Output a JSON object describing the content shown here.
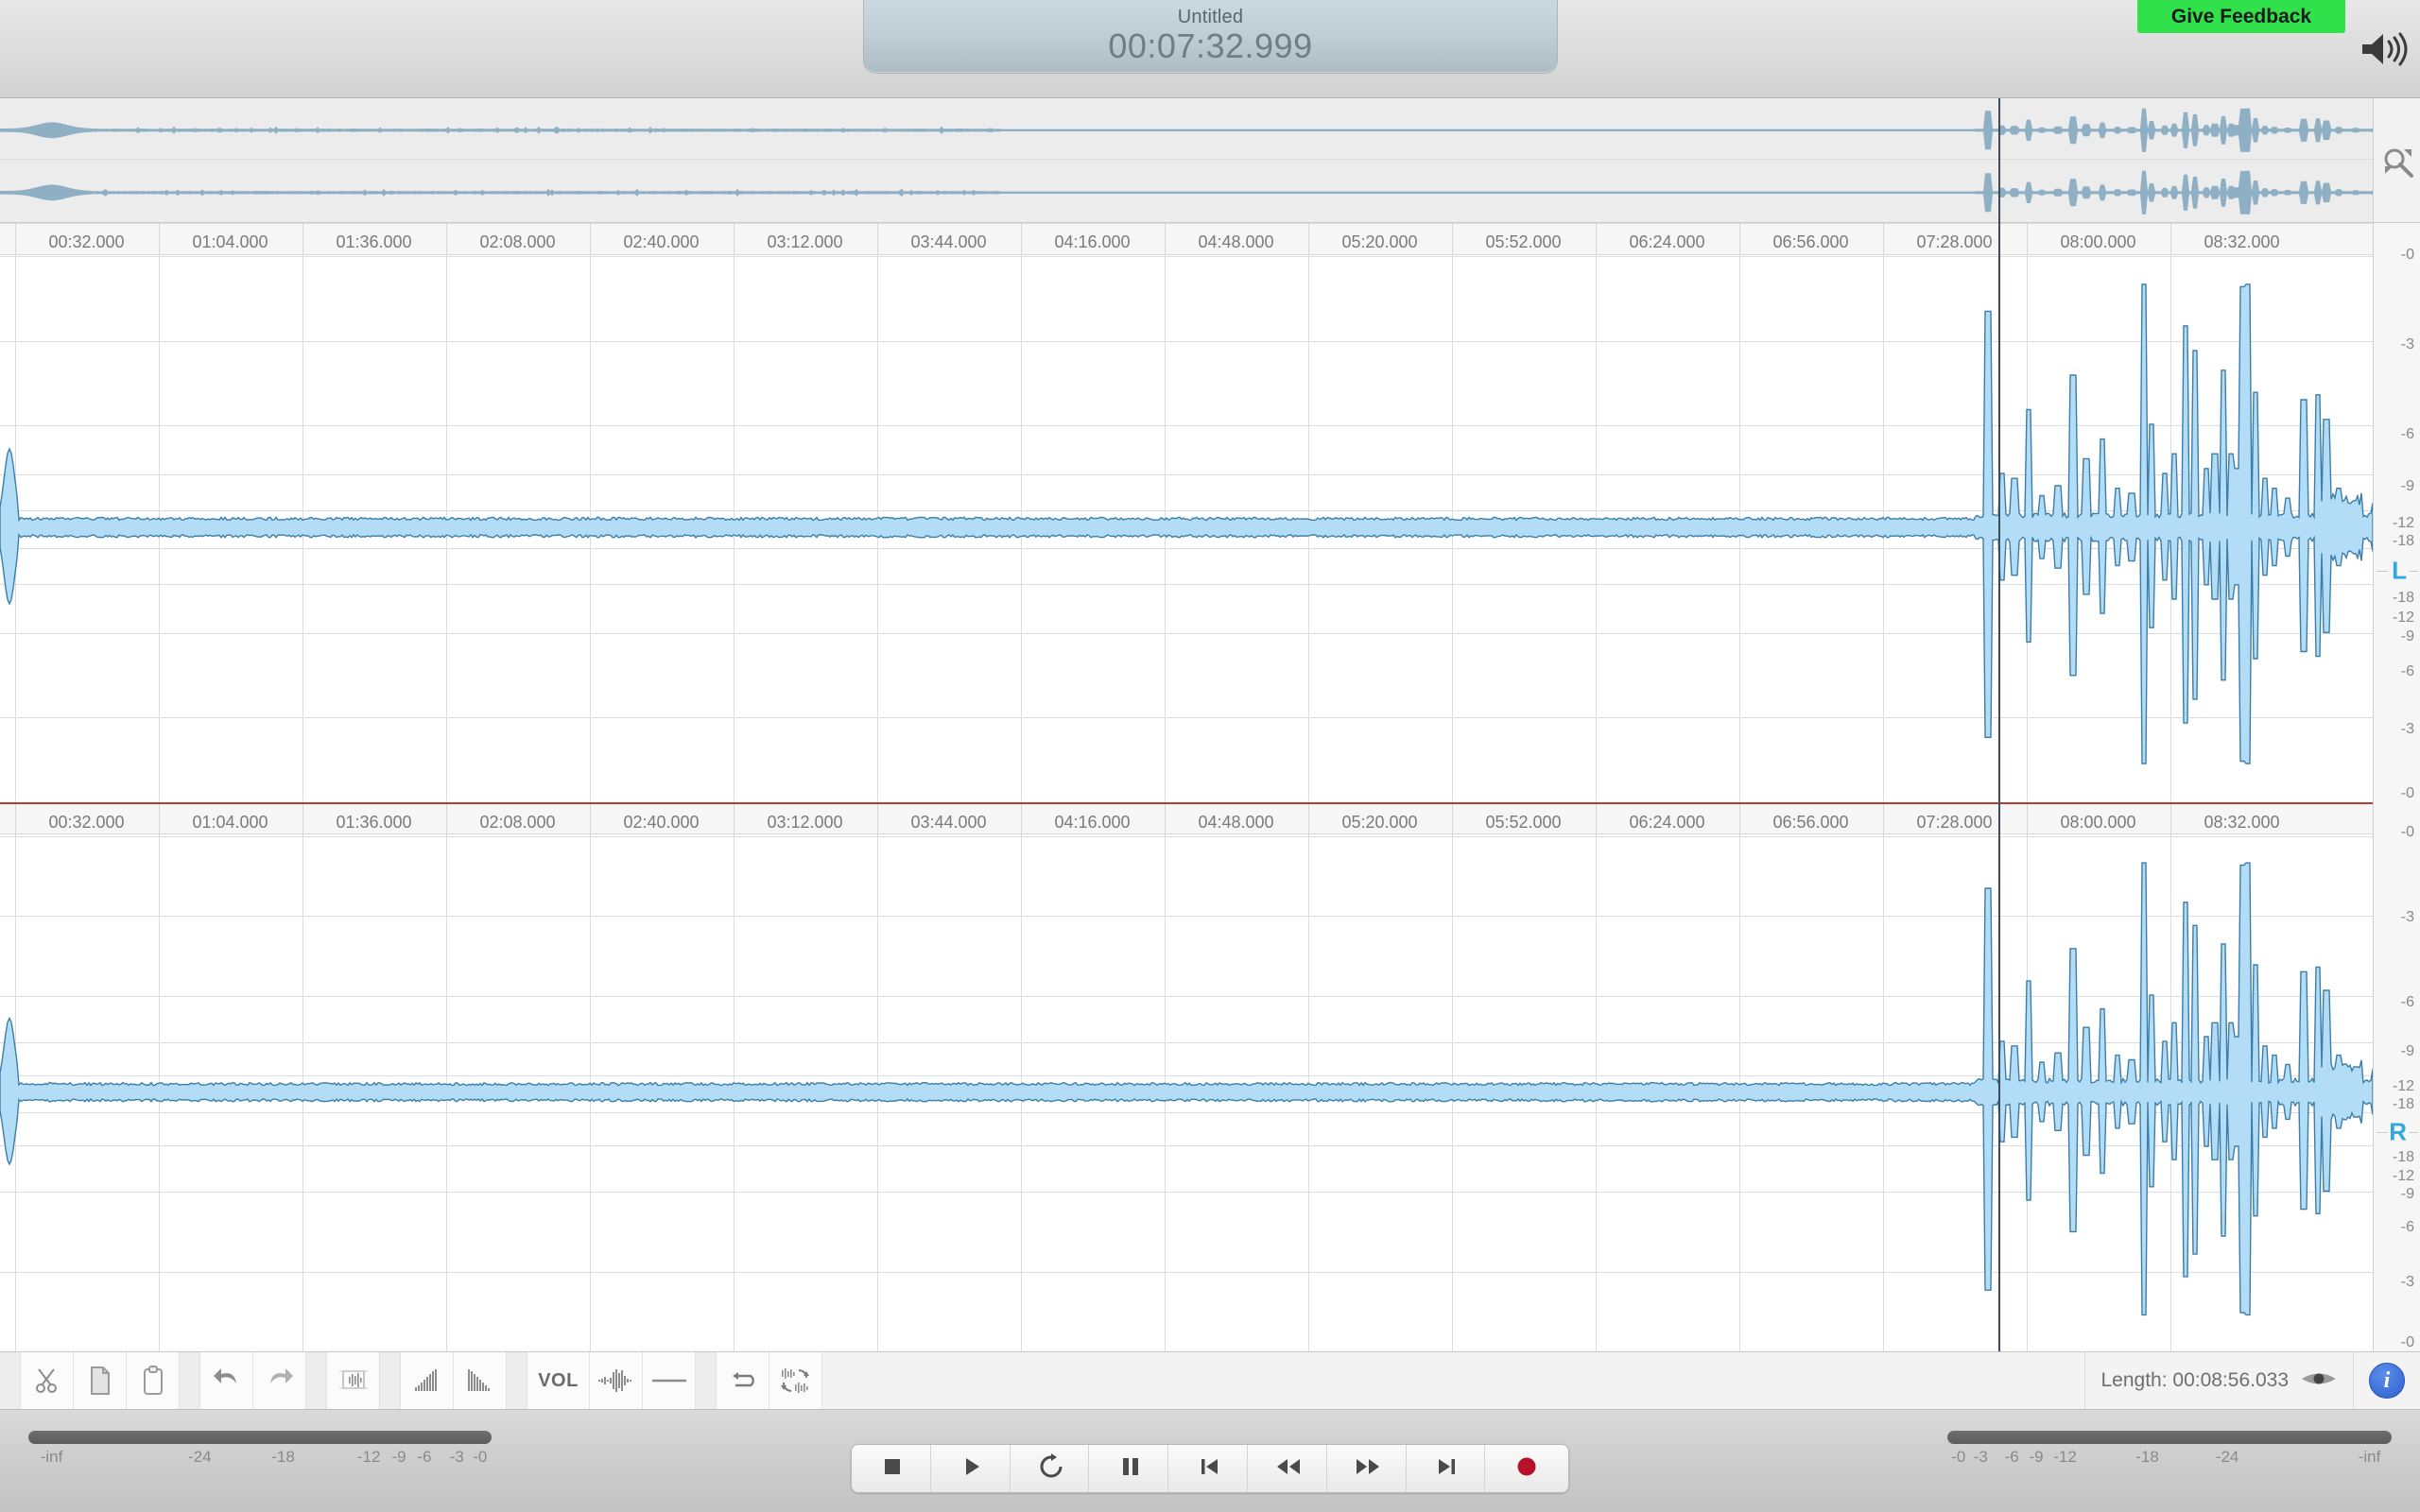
{
  "header": {
    "project_title": "Untitled",
    "playhead_time": "00:07:32.999",
    "feedback_label": "Give Feedback",
    "speaker_icon": "speaker-volume-icon",
    "feedback_color": "#31e14c"
  },
  "overview": {
    "zoom_icon": "zoom-magnifier-icon"
  },
  "ruler": {
    "labels": [
      "00:32.000",
      "01:04.000",
      "01:36.000",
      "02:08.000",
      "02:40.000",
      "03:12.000",
      "03:44.000",
      "04:16.000",
      "04:48.000",
      "05:20.000",
      "05:52.000",
      "06:24.000",
      "06:56.000",
      "07:28.000",
      "08:00.000",
      "08:32.000"
    ]
  },
  "scale": {
    "top_labels": [
      "-0",
      "-3",
      "-6",
      "-9",
      "-12",
      "-18"
    ],
    "bottom_labels": [
      "-18",
      "-12",
      "-9",
      "-6",
      "-3",
      "-0"
    ],
    "channel_left": "L",
    "channel_right": "R",
    "channel_color": "#31a8e0"
  },
  "toolbar": {
    "buttons": [
      {
        "name": "cut-button",
        "icon": "scissors-icon",
        "label": ""
      },
      {
        "name": "copy-button",
        "icon": "copy-icon",
        "label": ""
      },
      {
        "name": "paste-button",
        "icon": "paste-icon",
        "label": ""
      },
      {
        "name": "undo-button",
        "icon": "undo-arrow-icon",
        "label": ""
      },
      {
        "name": "redo-button",
        "icon": "redo-arrow-icon",
        "label": ""
      },
      {
        "name": "crop-selection-button",
        "icon": "crop-waveform-icon",
        "label": ""
      },
      {
        "name": "fade-in-button",
        "icon": "fade-in-icon",
        "label": ""
      },
      {
        "name": "fade-out-button",
        "icon": "fade-out-icon",
        "label": ""
      },
      {
        "name": "volume-button",
        "icon": "vol-text-icon",
        "label": "VOL"
      },
      {
        "name": "normalize-button",
        "icon": "normalize-waveform-icon",
        "label": ""
      },
      {
        "name": "silence-button",
        "icon": "horizontal-line-icon",
        "label": ""
      },
      {
        "name": "loop-region-button",
        "icon": "loop-arrow-icon",
        "label": ""
      },
      {
        "name": "reverse-button",
        "icon": "reverse-waveform-icon",
        "label": ""
      }
    ],
    "status_length": "Length: 00:08:56.033",
    "eye_icon": "eye-visibility-icon",
    "info_label": "i"
  },
  "transport": {
    "buttons": [
      {
        "name": "stop-button",
        "icon": "stop-square-icon"
      },
      {
        "name": "play-button",
        "icon": "play-triangle-icon"
      },
      {
        "name": "loop-playback-button",
        "icon": "loop-circle-icon"
      },
      {
        "name": "pause-button",
        "icon": "pause-bars-icon"
      },
      {
        "name": "skip-start-button",
        "icon": "skip-to-start-icon"
      },
      {
        "name": "rewind-button",
        "icon": "rewind-icon"
      },
      {
        "name": "fast-forward-button",
        "icon": "fast-forward-icon"
      },
      {
        "name": "skip-end-button",
        "icon": "skip-to-end-icon"
      },
      {
        "name": "record-button",
        "icon": "record-circle-icon"
      }
    ],
    "record_color": "#b51229"
  },
  "meters": {
    "left_labels": [
      "-inf",
      "-24",
      "-18",
      "-12",
      "-9",
      "-6",
      "-3",
      "-0"
    ],
    "right_labels": [
      "-0",
      "-3",
      "-6",
      "-9",
      "-12",
      "-18",
      "-24",
      "-inf"
    ]
  },
  "waveform": {
    "fill_color": "#b3ddf7",
    "stroke_color": "#3d7ea8",
    "overview_color": "#8fb0c4",
    "playhead_color": "#3d4d5c"
  }
}
